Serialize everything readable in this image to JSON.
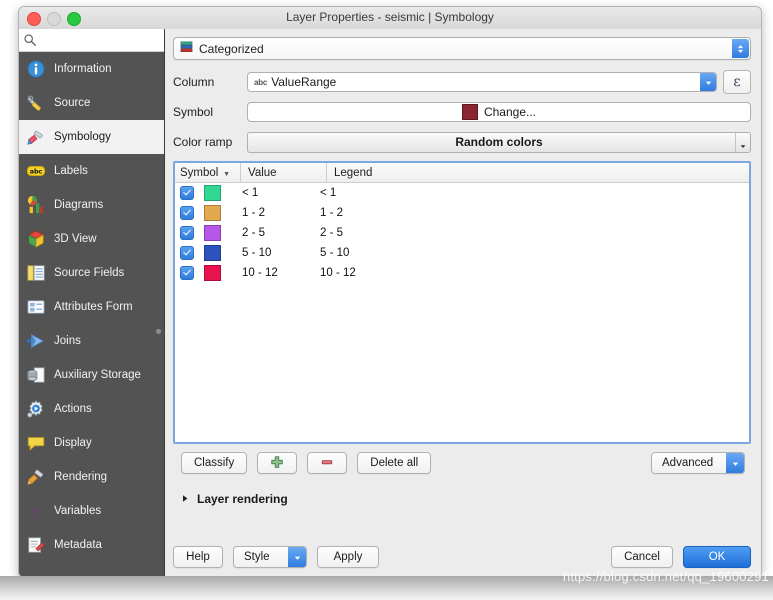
{
  "window": {
    "title": "Layer Properties - seismic | Symbology",
    "traffic_lights": [
      "close-button",
      "minimize-button",
      "maximize-button"
    ]
  },
  "sidebar": {
    "search": {
      "placeholder": "",
      "value": "",
      "icon": "search-icon"
    },
    "items": [
      {
        "label": "Information",
        "icon": "information-icon",
        "active": false
      },
      {
        "label": "Source",
        "icon": "source-icon",
        "active": false
      },
      {
        "label": "Symbology",
        "icon": "symbology-brush-icon",
        "active": true
      },
      {
        "label": "Labels",
        "icon": "labels-abc-icon",
        "active": false
      },
      {
        "label": "Diagrams",
        "icon": "diagrams-icon",
        "active": false
      },
      {
        "label": "3D View",
        "icon": "cube-3d-icon",
        "active": false
      },
      {
        "label": "Source Fields",
        "icon": "source-fields-icon",
        "active": false
      },
      {
        "label": "Attributes Form",
        "icon": "attributes-form-icon",
        "active": false
      },
      {
        "label": "Joins",
        "icon": "joins-icon",
        "active": false
      },
      {
        "label": "Auxiliary Storage",
        "icon": "auxiliary-storage-icon",
        "active": false
      },
      {
        "label": "Actions",
        "icon": "actions-gear-icon",
        "active": false
      },
      {
        "label": "Display",
        "icon": "display-balloon-icon",
        "active": false
      },
      {
        "label": "Rendering",
        "icon": "rendering-brush-icon",
        "active": false
      },
      {
        "label": "Variables",
        "icon": "variables-epsilon-icon",
        "active": false
      },
      {
        "label": "Metadata",
        "icon": "metadata-icon",
        "active": false
      }
    ]
  },
  "renderer": {
    "value": "Categorized",
    "icon": "categorized-stack-icon",
    "arrow_icon": "chevron-updown-icon"
  },
  "form": {
    "column": {
      "label": "Column",
      "value": "ValueRange",
      "type_badge": "abc",
      "arrow_icon": "chevron-down-icon",
      "expression_button": "ε"
    },
    "symbol": {
      "label": "Symbol",
      "change_label": "Change...",
      "color": "#8e2533"
    },
    "color_ramp": {
      "label": "Color ramp",
      "value": "Random colors",
      "arrow_icon": "chevron-down-icon"
    }
  },
  "table": {
    "columns": [
      "Symbol",
      "Value",
      "Legend"
    ],
    "sort_indicator": "▼",
    "rows": [
      {
        "checked": true,
        "color": "#30d894",
        "value": "< 1",
        "legend": "< 1"
      },
      {
        "checked": true,
        "color": "#e2a94e",
        "value": "1 - 2",
        "legend": "1 - 2"
      },
      {
        "checked": true,
        "color": "#b558e8",
        "value": "2 - 5",
        "legend": "2 - 5"
      },
      {
        "checked": true,
        "color": "#2a53bd",
        "value": "5 - 10",
        "legend": "5 - 10"
      },
      {
        "checked": true,
        "color": "#e8124f",
        "value": "10 - 12",
        "legend": "10 - 12"
      }
    ]
  },
  "tools": {
    "classify": "Classify",
    "add": "",
    "add_icon": "plus-icon",
    "remove": "",
    "remove_icon": "minus-icon",
    "delete_all": "Delete all",
    "advanced": "Advanced",
    "advanced_arrow": "chevron-down-icon"
  },
  "layer_rendering": {
    "label": "Layer rendering",
    "arrow_icon": "triangle-right-icon",
    "expanded": false
  },
  "footer": {
    "help": "Help",
    "style": "Style",
    "style_arrow": "chevron-down-icon",
    "apply": "Apply",
    "cancel": "Cancel",
    "ok": "OK"
  },
  "watermark": {
    "text": "https://blog.csdn.net/qq_19600291"
  },
  "colors": {
    "accent_blue": "#2f7cdd",
    "sidebar_bg": "#535353",
    "window_bg": "#ececec",
    "table_focus_border": "#7ba7e0"
  }
}
